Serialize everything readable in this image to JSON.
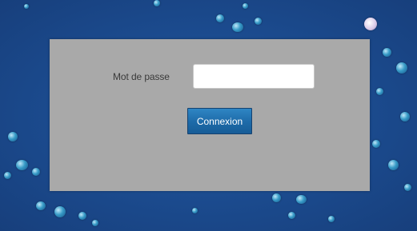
{
  "login": {
    "password_label": "Mot de passe",
    "password_value": "",
    "password_placeholder": "",
    "submit_label": "Connexion"
  },
  "colors": {
    "background": "#1d4f94",
    "panel": "#a9a9a9",
    "button": "#1d6aa8",
    "button_text": "#ffffff"
  }
}
